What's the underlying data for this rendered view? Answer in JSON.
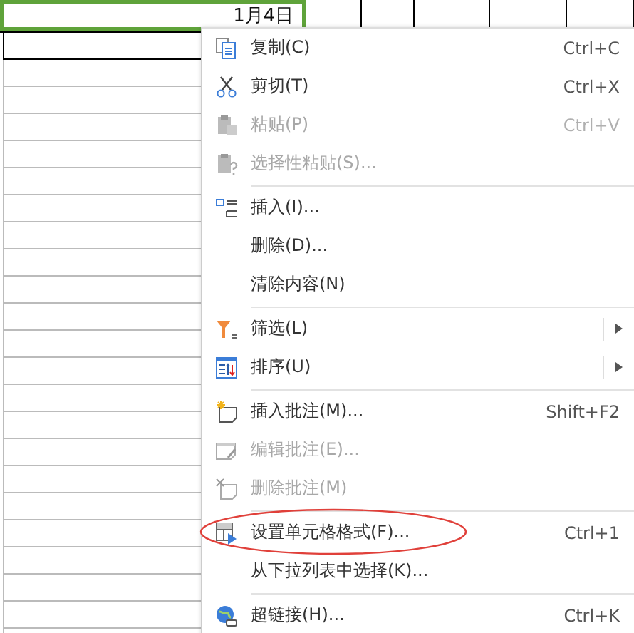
{
  "sheet": {
    "cells": [
      {
        "text": "1月4日",
        "selected": true
      }
    ]
  },
  "context_menu": {
    "items": [
      {
        "kind": "item",
        "label": "复制(C)",
        "shortcut": "Ctrl+C",
        "disabled": false
      },
      {
        "kind": "item",
        "label": "剪切(T)",
        "shortcut": "Ctrl+X",
        "disabled": false
      },
      {
        "kind": "item",
        "label": "粘贴(P)",
        "shortcut": "Ctrl+V",
        "disabled": true
      },
      {
        "kind": "item",
        "label": "选择性粘贴(S)...",
        "disabled": true
      },
      {
        "kind": "separator"
      },
      {
        "kind": "item",
        "label": "插入(I)...",
        "disabled": false
      },
      {
        "kind": "item",
        "label": "删除(D)...",
        "disabled": false
      },
      {
        "kind": "item",
        "label": "清除内容(N)",
        "disabled": false
      },
      {
        "kind": "separator"
      },
      {
        "kind": "item",
        "label": "筛选(L)",
        "disabled": false,
        "submenu": true
      },
      {
        "kind": "item",
        "label": "排序(U)",
        "disabled": false,
        "submenu": true
      },
      {
        "kind": "separator"
      },
      {
        "kind": "item",
        "label": "插入批注(M)...",
        "shortcut": "Shift+F2",
        "disabled": false
      },
      {
        "kind": "item",
        "label": "编辑批注(E)...",
        "disabled": true
      },
      {
        "kind": "item",
        "label": "删除批注(M)",
        "disabled": true
      },
      {
        "kind": "separator"
      },
      {
        "kind": "item",
        "label": "设置单元格格式(F)...",
        "shortcut": "Ctrl+1",
        "disabled": false,
        "circled": true
      },
      {
        "kind": "item",
        "label": "从下拉列表中选择(K)...",
        "disabled": false
      },
      {
        "kind": "separator"
      },
      {
        "kind": "item",
        "label": "超链接(H)...",
        "shortcut": "Ctrl+K",
        "disabled": false
      }
    ]
  }
}
